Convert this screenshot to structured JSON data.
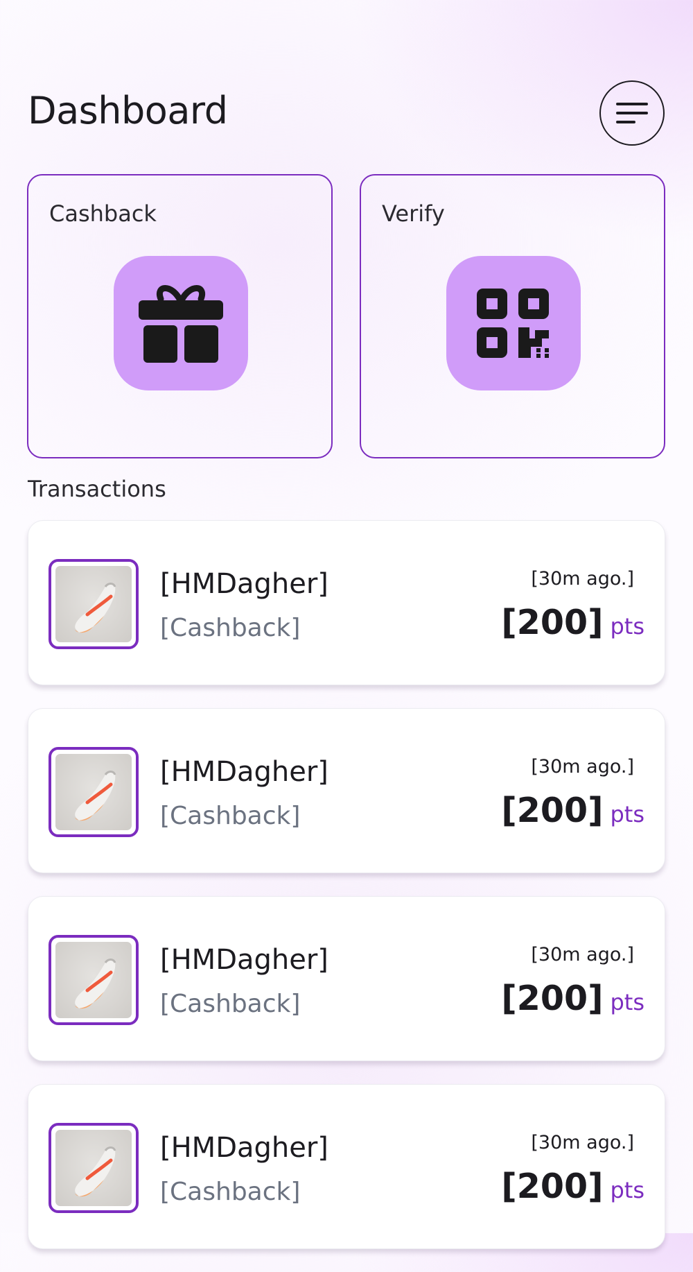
{
  "header": {
    "title": "Dashboard",
    "menu_icon": "menu-icon"
  },
  "actions": [
    {
      "label": "Cashback",
      "icon": "gift-icon"
    },
    {
      "label": "Verify",
      "icon": "qr-code-icon"
    }
  ],
  "transactions_title": "Transactions",
  "transactions": [
    {
      "name": "[HMDagher]",
      "type": "[Cashback]",
      "time": "[30m ago.]",
      "amount": "[200]",
      "unit": "pts"
    },
    {
      "name": "[HMDagher]",
      "type": "[Cashback]",
      "time": "[30m ago.]",
      "amount": "[200]",
      "unit": "pts"
    },
    {
      "name": "[HMDagher]",
      "type": "[Cashback]",
      "time": "[30m ago.]",
      "amount": "[200]",
      "unit": "pts"
    },
    {
      "name": "[HMDagher]",
      "type": "[Cashback]",
      "time": "[30m ago.]",
      "amount": "[200]",
      "unit": "pts"
    }
  ],
  "colors": {
    "accent": "#7b2cbf",
    "tile": "#d09cf9",
    "text": "#1c1b20",
    "muted": "#6b7280"
  }
}
